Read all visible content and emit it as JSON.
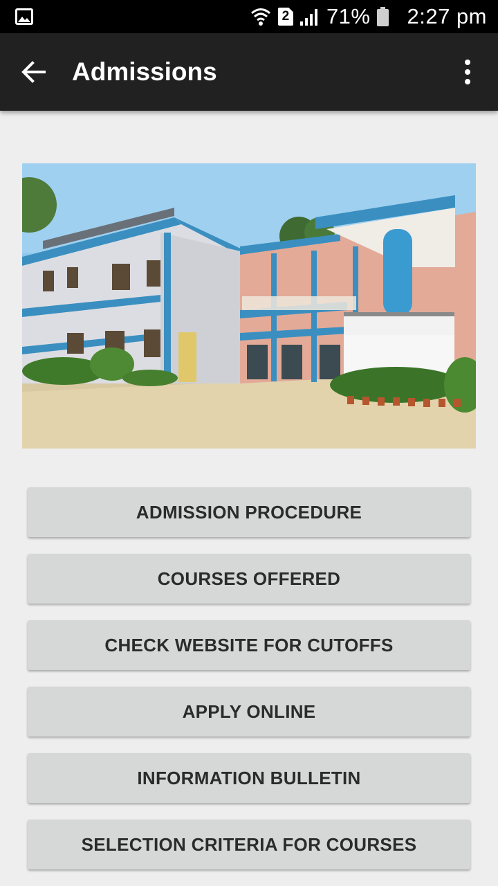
{
  "status_bar": {
    "icons": [
      "gallery-icon",
      "wifi-icon",
      "sim-icon",
      "signal-icon",
      "battery-icon"
    ],
    "sim_slot": "2",
    "battery": "71%",
    "time": "2:27 pm"
  },
  "app_bar": {
    "title": "Admissions",
    "back_icon": "arrow-left-icon",
    "menu_icon": "more-vert-icon",
    "background": "#212121"
  },
  "hero": {
    "icon": "college-building-photo"
  },
  "buttons": [
    {
      "label": "ADMISSION PROCEDURE"
    },
    {
      "label": "COURSES OFFERED"
    },
    {
      "label": "CHECK WEBSITE FOR CUTOFFS"
    },
    {
      "label": "APPLY ONLINE"
    },
    {
      "label": "INFORMATION BULLETIN"
    },
    {
      "label": "SELECTION CRITERIA FOR COURSES"
    }
  ],
  "colors": {
    "page_background": "#eeeeee",
    "button_background": "#d6d7d7",
    "button_text": "#2b2b2b"
  }
}
